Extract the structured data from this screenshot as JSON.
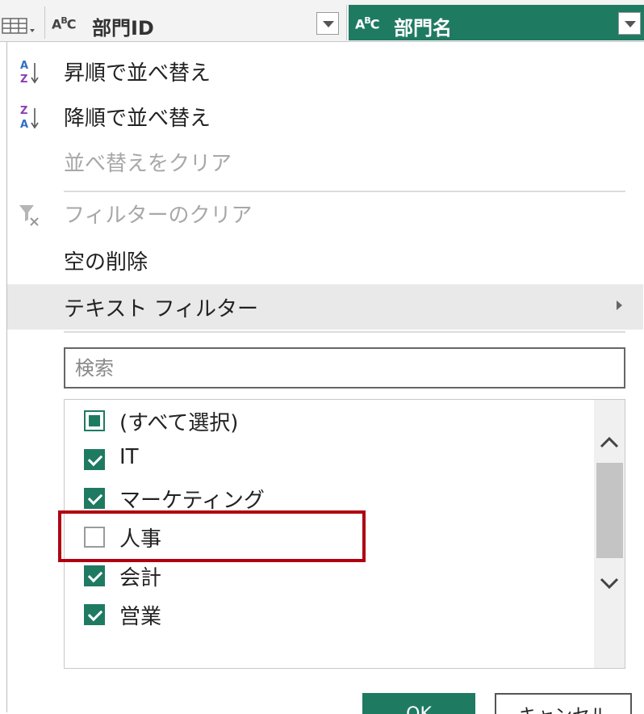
{
  "header": {
    "col1_type": "ABC",
    "col1_title": "部門ID",
    "col2_type": "ABC",
    "col2_title": "部門名"
  },
  "menu": {
    "sort_asc": "昇順で並べ替え",
    "sort_desc": "降順で並べ替え",
    "clear_sort": "並べ替えをクリア",
    "clear_filter": "フィルターのクリア",
    "remove_empty": "空の削除",
    "text_filter": "テキスト フィルター"
  },
  "search": {
    "placeholder": "検索"
  },
  "list": {
    "items": [
      {
        "label": "(すべて選択)",
        "state": "partial"
      },
      {
        "label": "IT",
        "state": "checked"
      },
      {
        "label": "マーケティング",
        "state": "checked"
      },
      {
        "label": "人事",
        "state": "unchecked"
      },
      {
        "label": "会計",
        "state": "checked"
      },
      {
        "label": "営業",
        "state": "checked"
      }
    ]
  },
  "buttons": {
    "ok": "OK",
    "cancel": "キャンセル"
  },
  "colors": {
    "accent": "#1f7a62",
    "highlight_border": "#b00010"
  }
}
